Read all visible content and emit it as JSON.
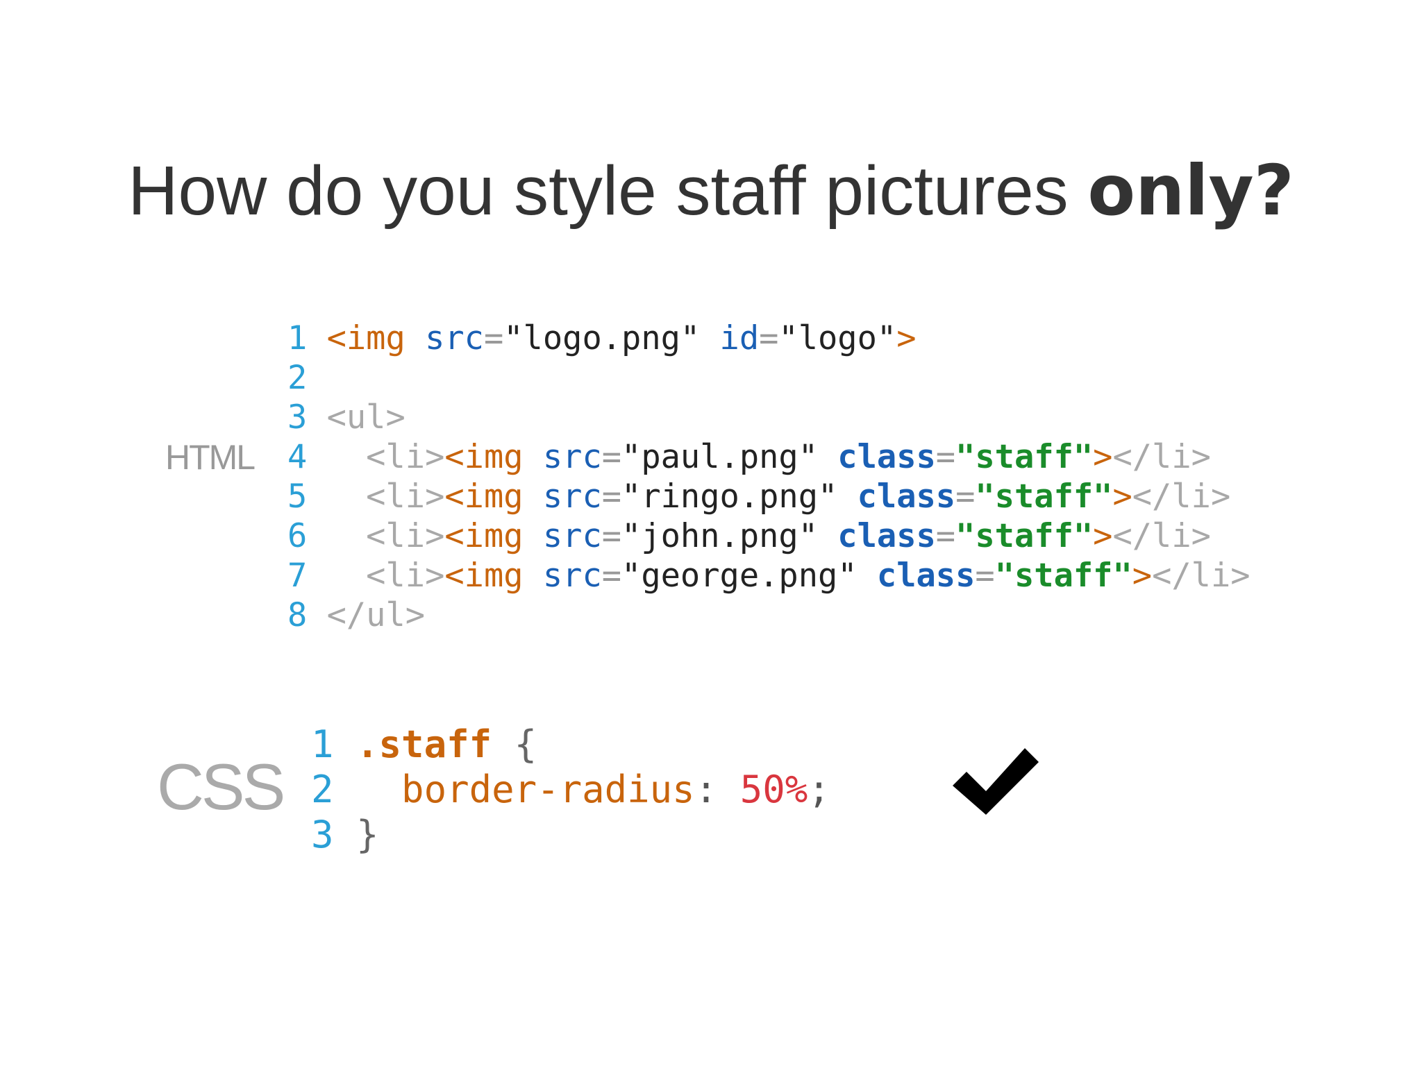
{
  "slide": {
    "title_regular": "How do you style staff pictures ",
    "title_bold": "only?"
  },
  "labels": {
    "html": "HTML",
    "css": "CSS"
  },
  "html_code": {
    "lines": [
      {
        "n": "1",
        "tokens": [
          {
            "t": "<img",
            "c": "tag"
          },
          {
            "t": " src",
            "c": "attr"
          },
          {
            "t": "=",
            "c": "eq"
          },
          {
            "t": "\"logo.png\"",
            "c": "str"
          },
          {
            "t": " id",
            "c": "attr"
          },
          {
            "t": "=",
            "c": "eq"
          },
          {
            "t": "\"logo\"",
            "c": "str"
          },
          {
            "t": ">",
            "c": "tag"
          }
        ]
      },
      {
        "n": "2",
        "tokens": []
      },
      {
        "n": "3",
        "tokens": [
          {
            "t": "<ul>",
            "c": "gray-tag"
          }
        ]
      },
      {
        "n": "4",
        "tokens": [
          {
            "t": "  <li>",
            "c": "gray-tag"
          },
          {
            "t": "<img",
            "c": "tag"
          },
          {
            "t": " src",
            "c": "attr"
          },
          {
            "t": "=",
            "c": "eq"
          },
          {
            "t": "\"paul.png\"",
            "c": "str"
          },
          {
            "t": " class",
            "c": "attr-bold"
          },
          {
            "t": "=",
            "c": "eq"
          },
          {
            "t": "\"staff\"",
            "c": "str-bold"
          },
          {
            "t": ">",
            "c": "tag"
          },
          {
            "t": "</li>",
            "c": "gray-tag"
          }
        ]
      },
      {
        "n": "5",
        "tokens": [
          {
            "t": "  <li>",
            "c": "gray-tag"
          },
          {
            "t": "<img",
            "c": "tag"
          },
          {
            "t": " src",
            "c": "attr"
          },
          {
            "t": "=",
            "c": "eq"
          },
          {
            "t": "\"ringo.png\"",
            "c": "str"
          },
          {
            "t": " class",
            "c": "attr-bold"
          },
          {
            "t": "=",
            "c": "eq"
          },
          {
            "t": "\"staff\"",
            "c": "str-bold"
          },
          {
            "t": ">",
            "c": "tag"
          },
          {
            "t": "</li>",
            "c": "gray-tag"
          }
        ]
      },
      {
        "n": "6",
        "tokens": [
          {
            "t": "  <li>",
            "c": "gray-tag"
          },
          {
            "t": "<img",
            "c": "tag"
          },
          {
            "t": " src",
            "c": "attr"
          },
          {
            "t": "=",
            "c": "eq"
          },
          {
            "t": "\"john.png\"",
            "c": "str"
          },
          {
            "t": " class",
            "c": "attr-bold"
          },
          {
            "t": "=",
            "c": "eq"
          },
          {
            "t": "\"staff\"",
            "c": "str-bold"
          },
          {
            "t": ">",
            "c": "tag"
          },
          {
            "t": "</li>",
            "c": "gray-tag"
          }
        ]
      },
      {
        "n": "7",
        "tokens": [
          {
            "t": "  <li>",
            "c": "gray-tag"
          },
          {
            "t": "<img",
            "c": "tag"
          },
          {
            "t": " src",
            "c": "attr"
          },
          {
            "t": "=",
            "c": "eq"
          },
          {
            "t": "\"george.png\"",
            "c": "str"
          },
          {
            "t": " class",
            "c": "attr-bold"
          },
          {
            "t": "=",
            "c": "eq"
          },
          {
            "t": "\"staff\"",
            "c": "str-bold"
          },
          {
            "t": ">",
            "c": "tag"
          },
          {
            "t": "</li>",
            "c": "gray-tag"
          }
        ]
      },
      {
        "n": "8",
        "tokens": [
          {
            "t": "</ul>",
            "c": "gray-tag"
          }
        ]
      }
    ]
  },
  "css_code": {
    "lines": [
      {
        "n": "1",
        "tokens": [
          {
            "t": ".staff",
            "c": "sel"
          },
          {
            "t": " {",
            "c": "brace"
          }
        ]
      },
      {
        "n": "2",
        "tokens": [
          {
            "t": "  border-radius",
            "c": "prop"
          },
          {
            "t": ": ",
            "c": "punct"
          },
          {
            "t": "50%",
            "c": "num"
          },
          {
            "t": ";",
            "c": "punct"
          }
        ]
      },
      {
        "n": "3",
        "tokens": [
          {
            "t": "}",
            "c": "brace"
          }
        ]
      }
    ]
  },
  "colors": {
    "line_number": "#2a9fd6",
    "tag": "#c8640c",
    "attribute": "#1a5fb4",
    "class_value": "#1a8c2a",
    "number": "#d9363e",
    "muted": "#a8a8a8"
  },
  "icons": {
    "result": "checkmark-icon"
  }
}
